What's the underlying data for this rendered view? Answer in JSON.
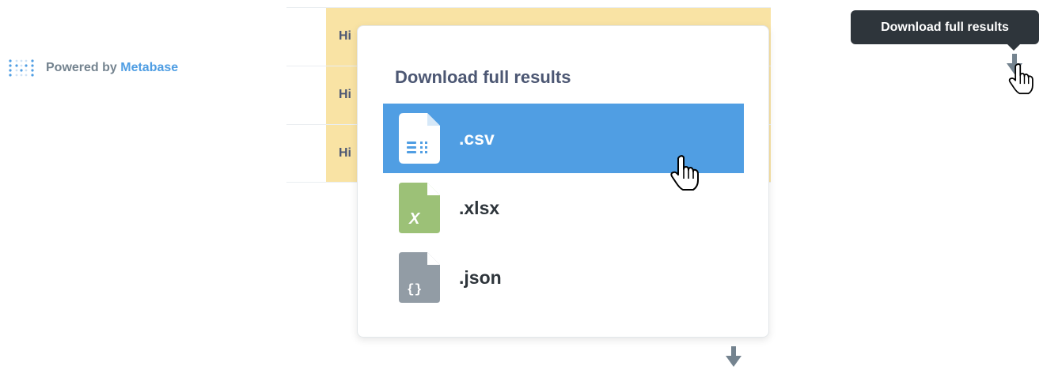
{
  "powered_by": {
    "prefix": "Powered by ",
    "brand": "Metabase",
    "logo_icon": "metabase-logo-icon"
  },
  "table": {
    "cells": [
      "Hi",
      "Hi",
      "Hi"
    ]
  },
  "download_popover": {
    "title": "Download full results",
    "options": [
      {
        "label": ".csv",
        "icon": "csv-file-icon",
        "color": "#ffffff",
        "glyph": "",
        "active": true
      },
      {
        "label": ".xlsx",
        "icon": "xlsx-file-icon",
        "color": "#9cc177",
        "glyph": "X",
        "active": false
      },
      {
        "label": ".json",
        "icon": "json-file-icon",
        "color": "#929ca5",
        "glyph": "{}",
        "active": false
      }
    ]
  },
  "tooltip": {
    "text": "Download full results"
  },
  "colors": {
    "accent": "#509ee3",
    "highlight_column": "#f9e3a4",
    "tooltip_bg": "#2e353b",
    "text_dark": "#4c5773"
  },
  "icons": {
    "download": "download-arrow-icon",
    "cursor": "hand-pointer-cursor-icon"
  }
}
